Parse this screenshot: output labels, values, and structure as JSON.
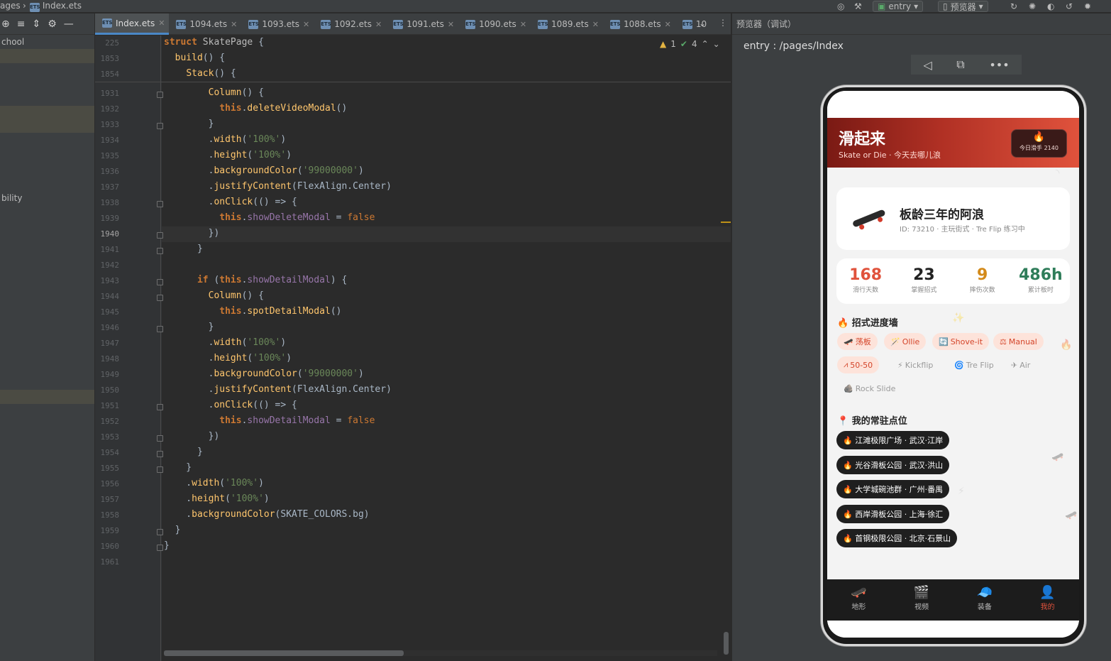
{
  "topbar": {
    "crumb_parent": "ages",
    "crumb_file": "Index.ets",
    "module_dropdown": "entry",
    "previewer_dropdown": "预览器"
  },
  "left_panel": {
    "rows": [
      {
        "text": "chool"
      },
      {
        "text": "bility"
      }
    ]
  },
  "tabs": [
    {
      "label": "Index.ets",
      "active": true
    },
    {
      "label": "1094.ets",
      "active": false
    },
    {
      "label": "1093.ets",
      "active": false
    },
    {
      "label": "1092.ets",
      "active": false
    },
    {
      "label": "1091.ets",
      "active": false
    },
    {
      "label": "1090.ets",
      "active": false
    },
    {
      "label": "1089.ets",
      "active": false
    },
    {
      "label": "1088.ets",
      "active": false
    },
    {
      "label": "10",
      "active": false
    }
  ],
  "editor": {
    "inspection_warnings": "1",
    "inspection_checks": "4",
    "sticky_lines": [
      {
        "n": "225",
        "code": "struct SkatePage {"
      },
      {
        "n": "1853",
        "code": "  build() {"
      },
      {
        "n": "1854",
        "code": "    Stack() {"
      }
    ],
    "lines": [
      {
        "n": "1931",
        "code": "        Column() {"
      },
      {
        "n": "1932",
        "code": "          this.deleteVideoModal()"
      },
      {
        "n": "1933",
        "code": "        }"
      },
      {
        "n": "1934",
        "code": "        .width('100%')"
      },
      {
        "n": "1935",
        "code": "        .height('100%')"
      },
      {
        "n": "1936",
        "code": "        .backgroundColor('99000000')"
      },
      {
        "n": "1937",
        "code": "        .justifyContent(FlexAlign.Center)"
      },
      {
        "n": "1938",
        "code": "        .onClick(() => {"
      },
      {
        "n": "1939",
        "code": "          this.showDeleteModal = false"
      },
      {
        "n": "1940",
        "code": "        })"
      },
      {
        "n": "1941",
        "code": "      }"
      },
      {
        "n": "1942",
        "code": ""
      },
      {
        "n": "1943",
        "code": "      if (this.showDetailModal) {"
      },
      {
        "n": "1944",
        "code": "        Column() {"
      },
      {
        "n": "1945",
        "code": "          this.spotDetailModal()"
      },
      {
        "n": "1946",
        "code": "        }"
      },
      {
        "n": "1947",
        "code": "        .width('100%')"
      },
      {
        "n": "1948",
        "code": "        .height('100%')"
      },
      {
        "n": "1949",
        "code": "        .backgroundColor('99000000')"
      },
      {
        "n": "1950",
        "code": "        .justifyContent(FlexAlign.Center)"
      },
      {
        "n": "1951",
        "code": "        .onClick(() => {"
      },
      {
        "n": "1952",
        "code": "          this.showDetailModal = false"
      },
      {
        "n": "1953",
        "code": "        })"
      },
      {
        "n": "1954",
        "code": "      }"
      },
      {
        "n": "1955",
        "code": "    }"
      },
      {
        "n": "1956",
        "code": "    .width('100%')"
      },
      {
        "n": "1957",
        "code": "    .height('100%')"
      },
      {
        "n": "1958",
        "code": "    .backgroundColor(SKATE_COLORS.bg)"
      },
      {
        "n": "1959",
        "code": "  }"
      },
      {
        "n": "1960",
        "code": "}"
      },
      {
        "n": "1961",
        "code": ""
      }
    ],
    "current_line": "1940"
  },
  "previewer": {
    "header": "预览器（调试）",
    "route": "entry : /pages/Index"
  },
  "app": {
    "title": "滑起来",
    "subtitle": "Skate or Die · 今天去哪儿浪",
    "badge_icon": "🔥",
    "badge_text": "今日滑手 2140",
    "profile": {
      "name": "板龄三年的阿浪",
      "meta": "ID: 73210 · 主玩街式 · Tre Flip 练习中"
    },
    "stats": [
      {
        "value": "168",
        "label": "滑行天数",
        "color": "#e0523c"
      },
      {
        "value": "23",
        "label": "掌握招式",
        "color": "#222222"
      },
      {
        "value": "9",
        "label": "摔伤次数",
        "color": "#d38a1a"
      },
      {
        "value": "486h",
        "label": "累计板时",
        "color": "#2f7d5a"
      }
    ],
    "tricks_title": "🔥 招式进度墙",
    "tricks": [
      {
        "icon": "🛹",
        "label": "荡板",
        "on": true
      },
      {
        "icon": "🪄",
        "label": "Ollie",
        "on": true
      },
      {
        "icon": "🔄",
        "label": "Shove-it",
        "on": true
      },
      {
        "icon": "⚖",
        "label": "Manual",
        "on": true
      },
      {
        "icon": "⩘",
        "label": "50-50",
        "on": true
      },
      {
        "icon": "⚡",
        "label": "Kickflip",
        "on": false
      },
      {
        "icon": "🌀",
        "label": "Tre Flip",
        "on": false
      },
      {
        "icon": "✈",
        "label": "Air",
        "on": false
      },
      {
        "icon": "🪨",
        "label": "Rock Slide",
        "on": false
      }
    ],
    "spots_title": "📍 我的常驻点位",
    "spots": [
      {
        "label": "🔥 江滩极限广场 · 武汉·江岸"
      },
      {
        "label": "🔥 光谷滑板公园 · 武汉·洪山"
      },
      {
        "label": "🔥 大学城碗池群 · 广州·番禺"
      },
      {
        "label": "🔥 西岸滑板公园 · 上海·徐汇"
      },
      {
        "label": "🔥 首钢极限公园 · 北京·石景山"
      }
    ],
    "nav": [
      {
        "icon": "🛹",
        "label": "地形",
        "active": false
      },
      {
        "icon": "🎬",
        "label": "视频",
        "active": false
      },
      {
        "icon": "🧢",
        "label": "装备",
        "active": false
      },
      {
        "icon": "👤",
        "label": "我的",
        "active": true
      }
    ]
  }
}
